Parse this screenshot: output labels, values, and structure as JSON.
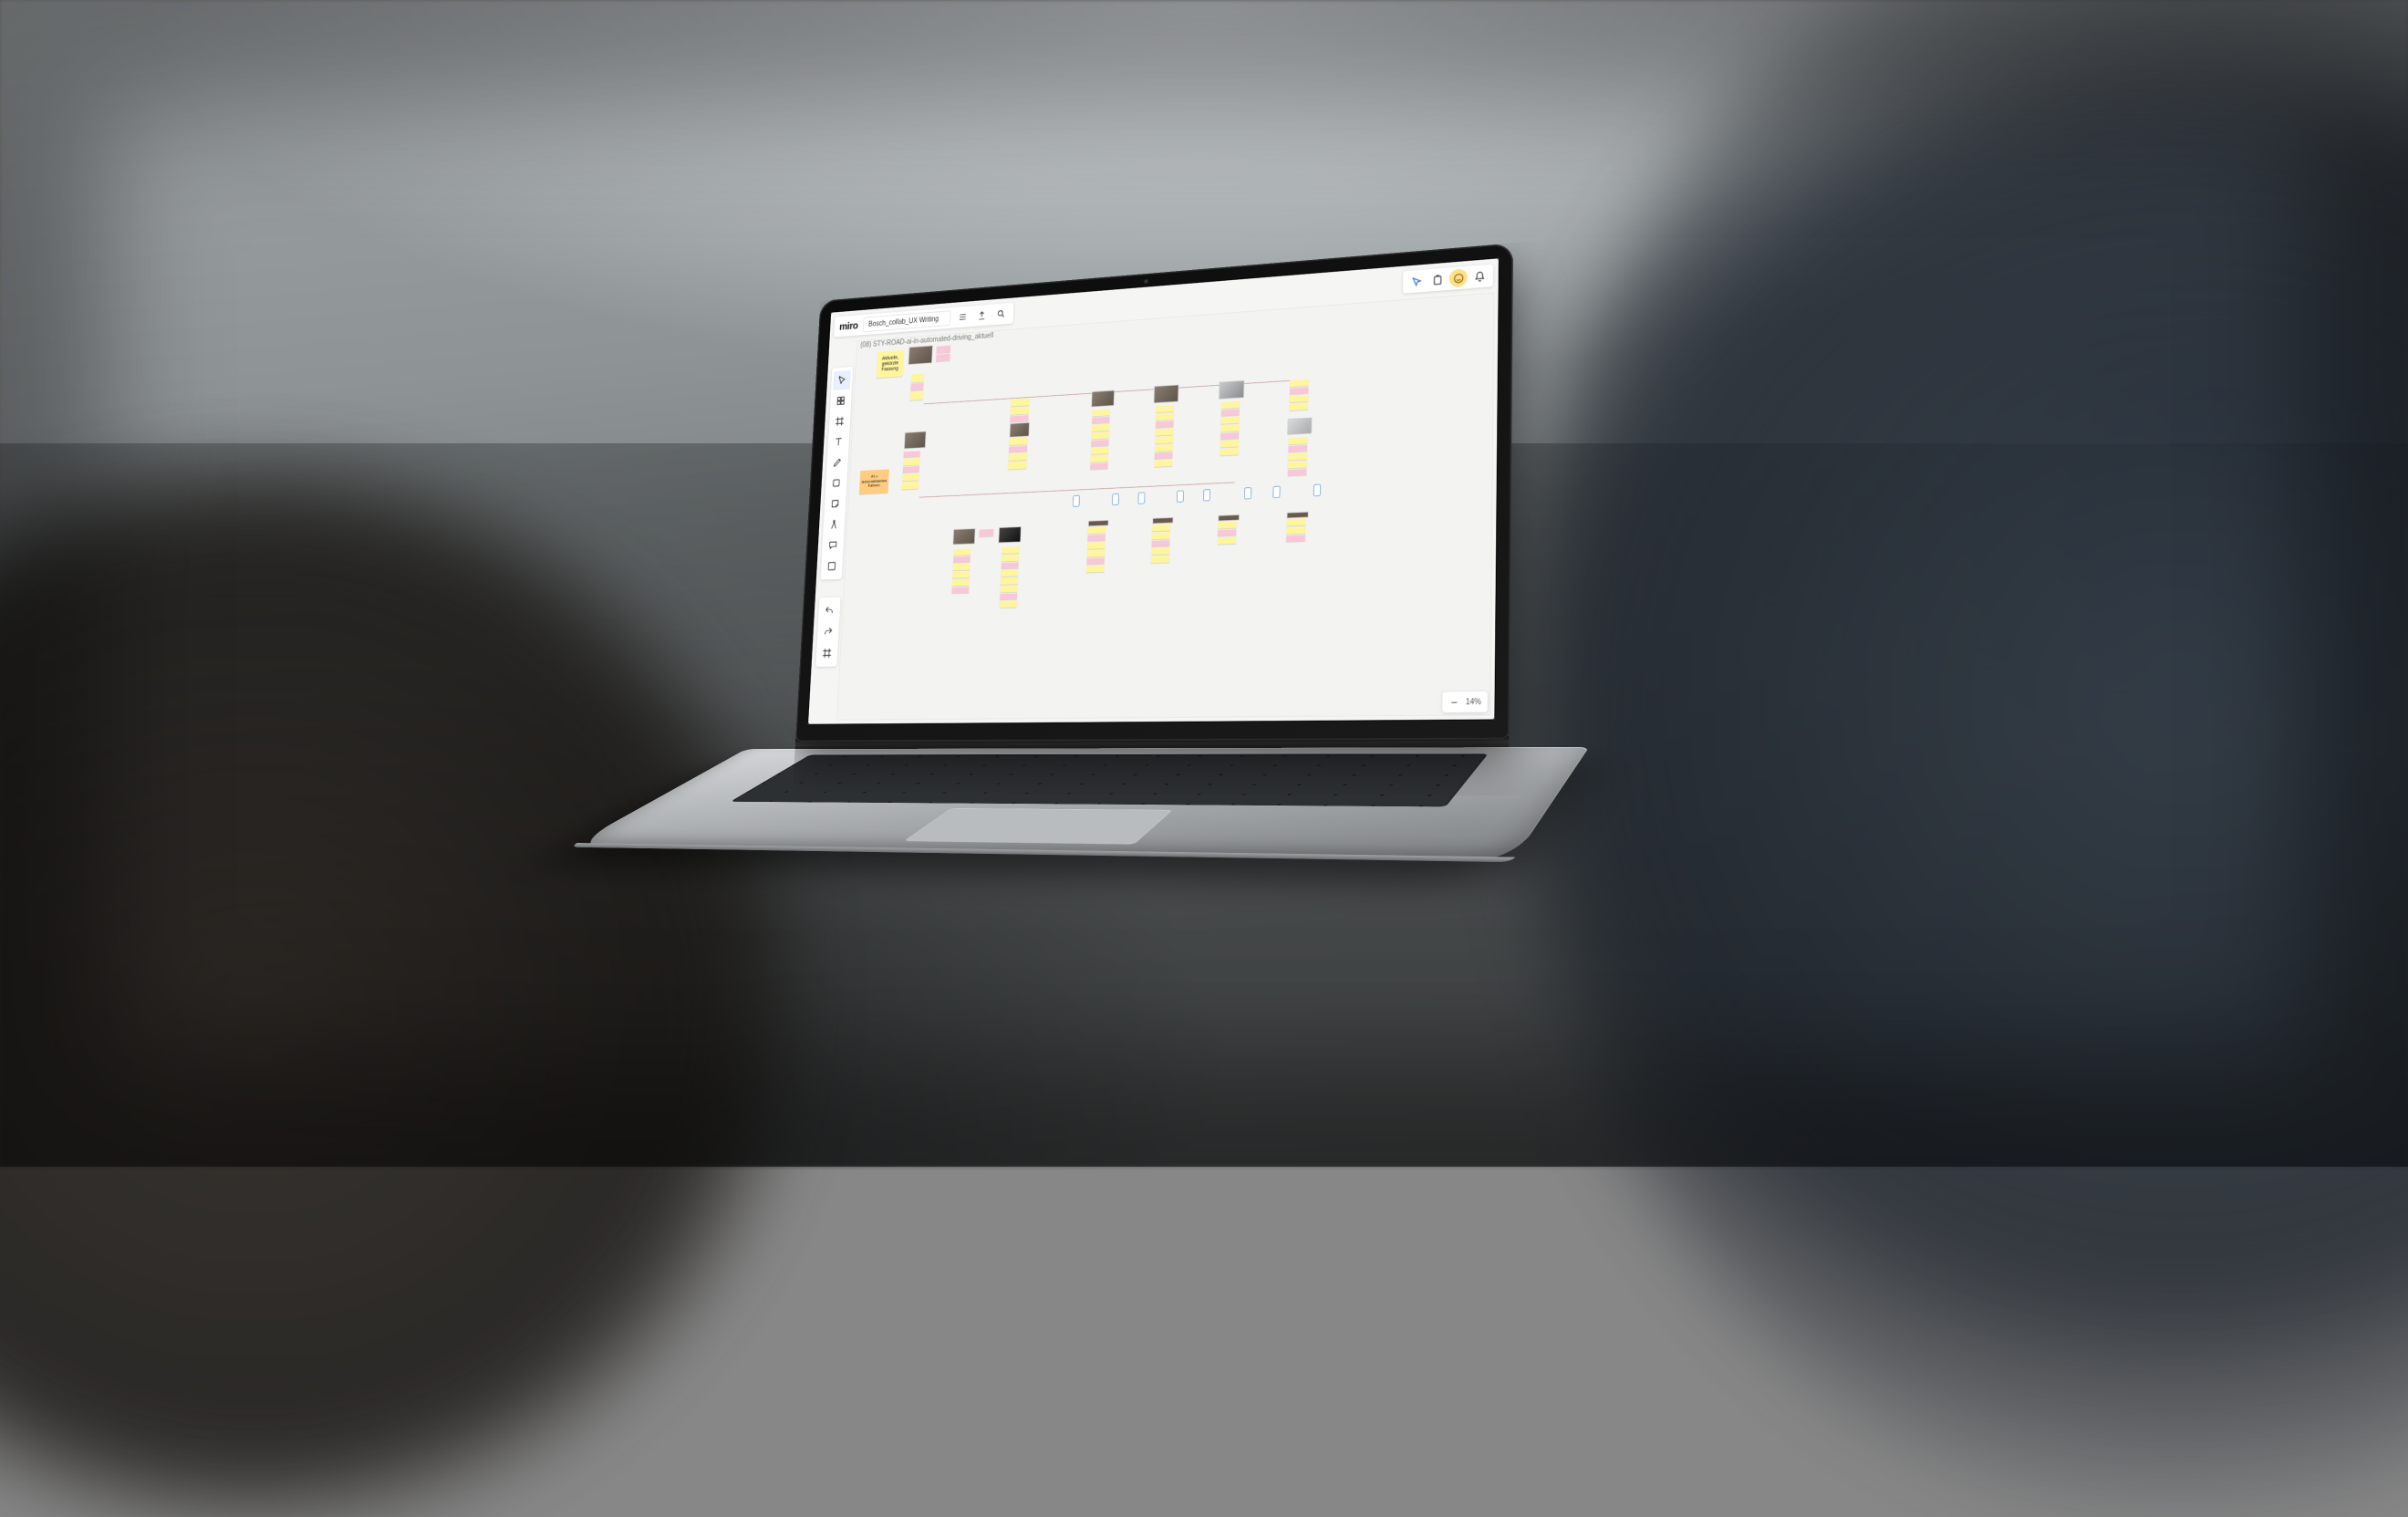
{
  "app": {
    "logo": "miro",
    "board_title": "Bosch_collab_UX Writing",
    "frame_label": "(08) STY-ROAD-ai-in-automated-driving_aktuell"
  },
  "topbar_icons": {
    "menu": "menu-icon",
    "export": "export-icon",
    "search": "search-icon"
  },
  "topright": {
    "cursor": "cursor-tracking-icon",
    "timer": "timer-icon",
    "reactions": "reactions-icon",
    "notifications": "bell-icon"
  },
  "tools": [
    {
      "name": "select",
      "icon": "cursor-icon",
      "active": true
    },
    {
      "name": "templates",
      "icon": "template-icon"
    },
    {
      "name": "frame",
      "icon": "frame-icon"
    },
    {
      "name": "text",
      "icon": "text-icon"
    },
    {
      "name": "pen",
      "icon": "pen-icon"
    },
    {
      "name": "shapes",
      "icon": "shapes-icon"
    },
    {
      "name": "sticky",
      "icon": "sticky-icon"
    },
    {
      "name": "connect",
      "icon": "compass-icon"
    },
    {
      "name": "comment",
      "icon": "comment-icon"
    },
    {
      "name": "more",
      "icon": "plus-icon"
    }
  ],
  "tools_lower": [
    {
      "name": "undo",
      "icon": "undo-icon"
    },
    {
      "name": "redo",
      "icon": "redo-icon"
    },
    {
      "name": "fit",
      "icon": "fit-icon"
    }
  ],
  "zoom": {
    "minus": "−",
    "level": "14%",
    "plus": "+"
  },
  "canvas": {
    "yellow_note_main": "Aktuelle,\ngekürzte\nFassung",
    "orange_note": "AI +\nautomatisiertes\nFahren"
  }
}
